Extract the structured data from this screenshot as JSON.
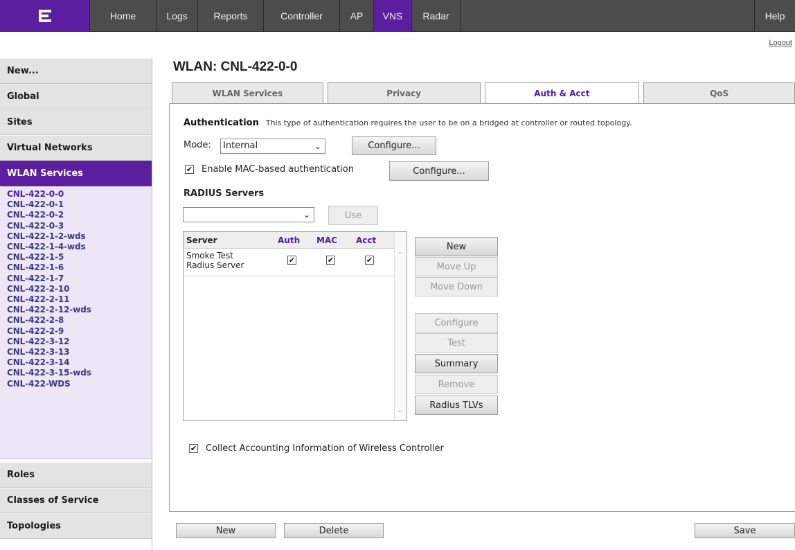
{
  "nav": {
    "logo": "extreme-logo",
    "items": [
      "Home",
      "Logs",
      "Reports",
      "Controller",
      "AP",
      "VNS",
      "Radar",
      "Help"
    ],
    "logout": "Logout"
  },
  "sidebar": {
    "top_items": [
      "New...",
      "Global",
      "Sites",
      "Virtual Networks",
      "WLAN Services"
    ],
    "wlan_list": [
      "CNL-422-0-0",
      "CNL-422-0-1",
      "CNL-422-0-2",
      "CNL-422-0-3",
      "CNL-422-1-2-wds",
      "CNL-422-1-4-wds",
      "CNL-422-1-5",
      "CNL-422-1-6",
      "CNL-422-1-7",
      "CNL-422-2-10",
      "CNL-422-2-11",
      "CNL-422-2-12-wds",
      "CNL-422-2-8",
      "CNL-422-2-9",
      "CNL-422-3-12",
      "CNL-422-3-13",
      "CNL-422-3-14",
      "CNL-422-3-15-wds",
      "CNL-422-WDS"
    ],
    "bottom_items": [
      "Roles",
      "Classes of Service",
      "Topologies"
    ]
  },
  "page": {
    "title": "WLAN: CNL-422-0-0",
    "tabs": [
      "WLAN Services",
      "Privacy",
      "Auth & Acct",
      "QoS"
    ]
  },
  "auth": {
    "heading": "Authentication",
    "note": "This type of authentication requires the user to be on a bridged at controller or routed topology.",
    "mode_label": "Mode:",
    "mode_value": "Internal",
    "configure": "Configure...",
    "mac_label": "Enable MAC-based authentication",
    "mac_configure": "Configure...",
    "radius_heading": "RADIUS Servers",
    "use": "Use",
    "table": {
      "headers": [
        "Server",
        "Auth",
        "MAC",
        "Acct"
      ],
      "rows": [
        {
          "server_line1": "Smoke Test",
          "server_line2": "Radius Server",
          "auth": "✔",
          "mac": "✔",
          "acct": "✔"
        }
      ]
    },
    "side_buttons": [
      "New",
      "Move Up",
      "Move Down",
      "Configure",
      "Test",
      "Summary",
      "Remove",
      "Radius TLVs"
    ],
    "collect_label": "Collect Accounting Information of Wireless Controller"
  },
  "footer": {
    "new": "New",
    "delete": "Delete",
    "save": "Save"
  },
  "colors": {
    "accent": "#5b1e9e",
    "nav_bg": "#4c4c4c"
  }
}
